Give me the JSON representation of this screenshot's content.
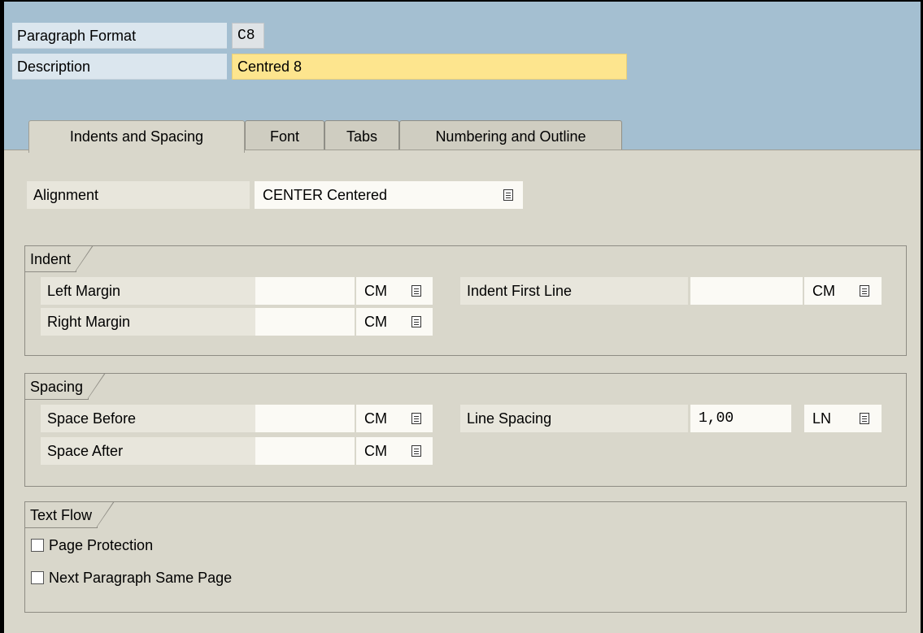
{
  "header": {
    "paragraph_format_label": "Paragraph Format",
    "paragraph_format_value": "C8",
    "description_label": "Description",
    "description_value": "Centred 8"
  },
  "tabs": [
    {
      "label": "Indents and Spacing",
      "active": true
    },
    {
      "label": "Font",
      "active": false
    },
    {
      "label": "Tabs",
      "active": false
    },
    {
      "label": "Numbering and Outline",
      "active": false
    }
  ],
  "alignment": {
    "label": "Alignment",
    "value": "CENTER Centered",
    "icon": "f4-help-icon"
  },
  "indent": {
    "title": "Indent",
    "left_margin_label": "Left Margin",
    "left_margin_value": "",
    "left_margin_unit": "CM",
    "right_margin_label": "Right Margin",
    "right_margin_value": "",
    "right_margin_unit": "CM",
    "first_line_label": "Indent First Line",
    "first_line_value": "",
    "first_line_unit": "CM"
  },
  "spacing": {
    "title": "Spacing",
    "space_before_label": "Space Before",
    "space_before_value": "",
    "space_before_unit": "CM",
    "space_after_label": "Space After",
    "space_after_value": "",
    "space_after_unit": "CM",
    "line_spacing_label": "Line Spacing",
    "line_spacing_value": "1,00",
    "line_spacing_unit": "LN"
  },
  "text_flow": {
    "title": "Text Flow",
    "page_protection_label": "Page Protection",
    "page_protection_checked": false,
    "next_paragraph_label": "Next Paragraph Same Page",
    "next_paragraph_checked": false
  },
  "colors": {
    "header_bg": "#a4bfd1",
    "panel_bg": "#d9d7cb",
    "required_field_bg": "#fde58e"
  }
}
